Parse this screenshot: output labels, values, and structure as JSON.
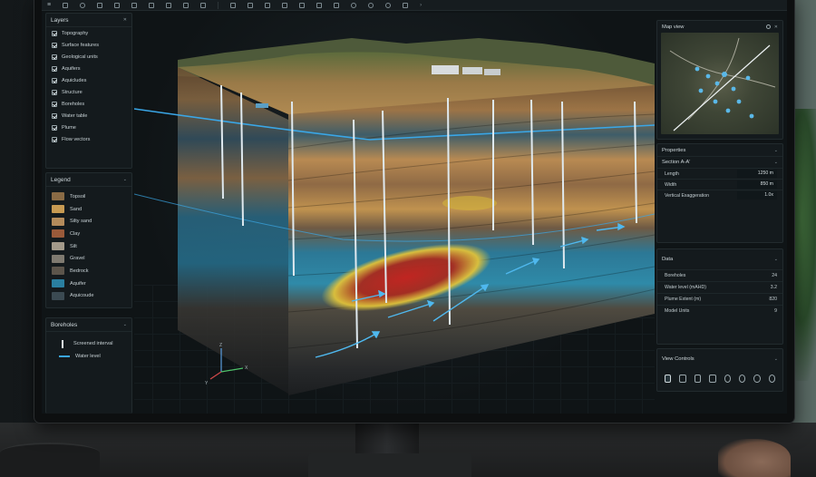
{
  "layers": {
    "title": "Layers",
    "items": [
      {
        "label": "Topography"
      },
      {
        "label": "Surface features"
      },
      {
        "label": "Geological units"
      },
      {
        "label": "Aquifers"
      },
      {
        "label": "Aquicludes"
      },
      {
        "label": "Structure"
      },
      {
        "label": "Boreholes"
      },
      {
        "label": "Water table"
      },
      {
        "label": "Plume"
      },
      {
        "label": "Flow vectors"
      }
    ]
  },
  "legend": {
    "title": "Legend",
    "items": [
      {
        "label": "Topsoil",
        "color": "#8a6b45"
      },
      {
        "label": "Sand",
        "color": "#c79a52"
      },
      {
        "label": "Silty sand",
        "color": "#b48b5b"
      },
      {
        "label": "Clay",
        "color": "#9a5a3a"
      },
      {
        "label": "Silt",
        "color": "#a39a8a"
      },
      {
        "label": "Gravel",
        "color": "#7f7a70"
      },
      {
        "label": "Bedrock",
        "color": "#5c554b"
      },
      {
        "label": "Aquifer",
        "color": "#2a7fa0"
      },
      {
        "label": "Aquicoude",
        "color": "#3b4a52"
      }
    ]
  },
  "boreholes_panel": {
    "title": "Boreholes",
    "screened_label": "Screened interval",
    "water_label": "Water level"
  },
  "map_view": {
    "title": "Map view"
  },
  "properties": {
    "title": "Properties",
    "section_label": "Section A-A'",
    "rows": [
      {
        "label": "Length",
        "value": "1250 m"
      },
      {
        "label": "Width",
        "value": "850 m"
      },
      {
        "label": "Vertical Exaggeration",
        "value": "1.0x"
      }
    ]
  },
  "data_panel": {
    "title": "Data",
    "rows": [
      {
        "label": "Boreholes",
        "value": "24"
      },
      {
        "label": "Water level (mAHD)",
        "value": "3.2"
      },
      {
        "label": "Plume Extent (m)",
        "value": "820"
      },
      {
        "label": "Model Units",
        "value": "9"
      }
    ]
  },
  "view_controls": {
    "title": "View Controls"
  },
  "axes": {
    "z": "Z",
    "x": "X",
    "y": "Y"
  },
  "colors": {
    "water": "#3aa6e6",
    "plume_core": "#c8201a",
    "plume_edge": "#e0c23a",
    "accent": "#2a9fd6"
  }
}
